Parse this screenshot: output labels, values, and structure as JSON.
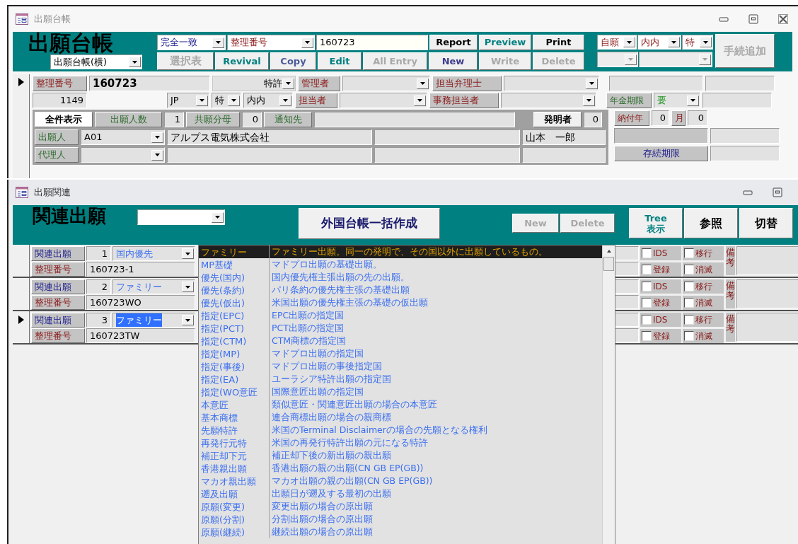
{
  "main_window": {
    "title": "出願台帳",
    "current_record": true,
    "header": {
      "heading": "出願台帳",
      "match_mode": "完全一致",
      "search_field": "整理番号",
      "search_value": "160723",
      "view": "出願台帳(横)",
      "buttons_top": [
        {
          "label": "Report",
          "color": "#000000",
          "disabled": false
        },
        {
          "label": "Preview",
          "color": "#008080",
          "disabled": false
        },
        {
          "label": "Print",
          "color": "#000000",
          "disabled": false
        }
      ],
      "buttons_bottom": [
        {
          "label": "選択表",
          "disabled": true
        },
        {
          "label": "Revival",
          "color": "#008080",
          "disabled": false
        },
        {
          "label": "Copy",
          "color": "#4b5a9a",
          "disabled": false
        },
        {
          "label": "Edit",
          "color": "#008080",
          "disabled": false
        },
        {
          "label": "All Entry",
          "disabled": true
        },
        {
          "label": "New",
          "color": "#3c3c8c",
          "disabled": false
        },
        {
          "label": "Write",
          "disabled": true
        },
        {
          "label": "Delete",
          "disabled": true
        }
      ],
      "filters": [
        {
          "value": "自願",
          "disabled": false
        },
        {
          "value": "内内",
          "disabled": false
        },
        {
          "value": "特",
          "disabled": false
        }
      ],
      "filters_second_row": [
        {
          "disabled": true
        },
        {
          "disabled": true
        }
      ],
      "add_procedure": {
        "label": "手続追加",
        "disabled": true
      }
    },
    "record": {
      "number_label": "整理番号",
      "number": "160723",
      "category": "特許",
      "manager_label": "管理者",
      "attorney_label": "担当弁理士",
      "serial": "1149",
      "country": "JP",
      "kind": "特",
      "route": "内内",
      "staff_label": "担当者",
      "clerk_label": "事務担当者",
      "show_all": "全件表示",
      "applicant_count_label": "出願人数",
      "applicant_count": "1",
      "share_label": "共願分母",
      "share": "0",
      "notify_label": "通知先",
      "inventor_button": "発明者",
      "inventor_count": "0",
      "applicant_label": "出願人",
      "applicant_code": "A01",
      "applicant_name": "アルプス電気株式会社",
      "inventor": "山本　一郎",
      "agent_label": "代理人",
      "annuity_label": "年金期限",
      "annuity": "要",
      "pay_year_label": "納付年",
      "pay_year": "0",
      "month_label": "月",
      "month": "0",
      "expiry_label": "存続期限"
    }
  },
  "related_window": {
    "title": "出願関連",
    "heading": "関連出願",
    "bulk_button": "外国台帳一括作成",
    "buttons": [
      {
        "label": "New",
        "disabled": true
      },
      {
        "label": "Delete",
        "disabled": true
      }
    ],
    "tree_button": [
      "Tree",
      "表示"
    ],
    "ref_button": "参照",
    "switch_button": "切替",
    "records": [
      {
        "current": false,
        "label": "関連出願",
        "index": "1",
        "relation": "国内優先",
        "relation_selected": false,
        "number_label": "整理番号",
        "number": "160723-1",
        "flags": [
          {
            "label": "IDS",
            "checked": false
          },
          {
            "label": "移行",
            "checked": false
          },
          {
            "label": "登録",
            "checked": false
          },
          {
            "label": "消滅",
            "checked": false
          }
        ],
        "note_label": "備考"
      },
      {
        "current": false,
        "label": "関連出願",
        "index": "2",
        "relation": "ファミリー",
        "relation_selected": false,
        "number_label": "整理番号",
        "number": "160723WO",
        "flags": [
          {
            "label": "IDS",
            "checked": false
          },
          {
            "label": "移行",
            "checked": false
          },
          {
            "label": "登録",
            "checked": false
          },
          {
            "label": "消滅",
            "checked": false
          }
        ],
        "note_label": "備考"
      },
      {
        "current": true,
        "label": "関連出願",
        "index": "3",
        "relation": "ファミリー",
        "relation_selected": true,
        "number_label": "整理番号",
        "number": "160723TW",
        "flags": [
          {
            "label": "IDS",
            "checked": false
          },
          {
            "label": "移行",
            "checked": false
          },
          {
            "label": "登録",
            "checked": false
          },
          {
            "label": "消滅",
            "checked": false
          }
        ],
        "note_label": "備考"
      }
    ],
    "dropdown": {
      "items": [
        {
          "code": "ファミリー",
          "description": "ファミリー出願。同一の発明で、その国以外に出願しているもの。",
          "selected": true
        },
        {
          "code": "MP基礎",
          "description": "マドプロ出願の基礎出願。",
          "selected": false
        },
        {
          "code": "優先(国内)",
          "description": "国内優先権主張出願の先の出願。",
          "selected": false
        },
        {
          "code": "優先(条約)",
          "description": "パリ条約の優先権主張の基礎出願",
          "selected": false
        },
        {
          "code": "優先(仮出)",
          "description": "米国出願の優先権主張の基礎の仮出願",
          "selected": false
        },
        {
          "code": "指定(EPC)",
          "description": "EPC出願の指定国",
          "selected": false
        },
        {
          "code": "指定(PCT)",
          "description": "PCT出願の指定国",
          "selected": false
        },
        {
          "code": "指定(CTM)",
          "description": "CTM商標の指定国",
          "selected": false
        },
        {
          "code": "指定(MP)",
          "description": "マドプロ出願の指定国",
          "selected": false
        },
        {
          "code": "指定(事後)",
          "description": "マドプロ出願の事後指定国",
          "selected": false
        },
        {
          "code": "指定(EA)",
          "description": "ユーラシア特許出願の指定国",
          "selected": false
        },
        {
          "code": "指定(WO意匠",
          "description": "国際意匠出願の指定国",
          "selected": false
        },
        {
          "code": "本意匠",
          "description": "類似意匠・関連意匠出願の場合の本意匠",
          "selected": false
        },
        {
          "code": "基本商標",
          "description": "連合商標出願の場合の親商標",
          "selected": false
        },
        {
          "code": "先願特許",
          "description": "米国のTerminal Disclaimerの場合の先願となる権利",
          "selected": false
        },
        {
          "code": "再発行元特",
          "description": "米国の再発行特許出願の元になる特許",
          "selected": false
        },
        {
          "code": "補正却下元",
          "description": "補正却下後の新出願の親出願",
          "selected": false
        },
        {
          "code": "香港親出願",
          "description": "香港出願の親の出願(CN GB EP(GB))",
          "selected": false
        },
        {
          "code": "マカオ親出願",
          "description": "マカオ出願の親の出願(CN GB EP(GB))",
          "selected": false
        },
        {
          "code": "遡及出願",
          "description": "出願日が遡及する最初の出願",
          "selected": false
        },
        {
          "code": "原願(変更)",
          "description": "変更出願の場合の原出願",
          "selected": false
        },
        {
          "code": "原願(分割)",
          "description": "分割出願の場合の原出願",
          "selected": false
        },
        {
          "code": "原願(継続)",
          "description": "継続出願の場合の原出願",
          "selected": false
        }
      ]
    }
  }
}
